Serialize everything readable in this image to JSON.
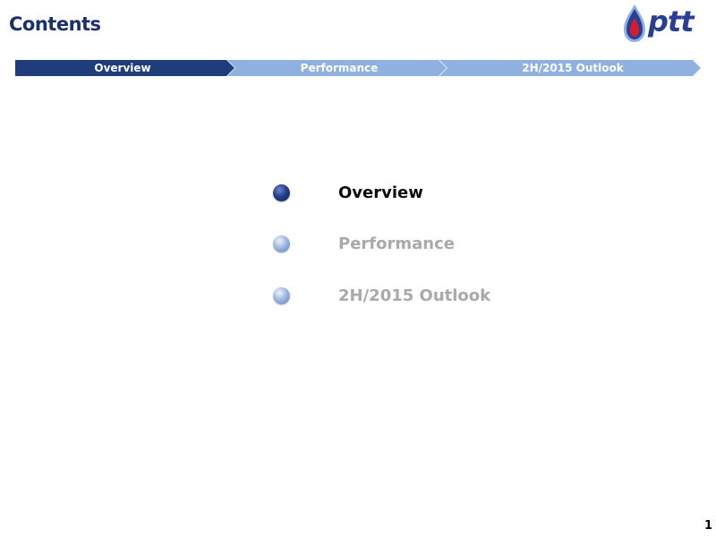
{
  "header": {
    "title": "Contents",
    "logo_text": "ptt"
  },
  "nav": {
    "steps": [
      {
        "label": "Overview",
        "active": true
      },
      {
        "label": "Performance",
        "active": false
      },
      {
        "label": "2H/2015 Outlook",
        "active": false
      }
    ]
  },
  "agenda": {
    "items": [
      {
        "label": "Overview",
        "active": true
      },
      {
        "label": "Performance",
        "active": false
      },
      {
        "label": "2H/2015 Outlook",
        "active": false
      }
    ]
  },
  "footer": {
    "page_number": "1"
  },
  "colors": {
    "title": "#1a2f6b",
    "nav_active": "#1f3d7a",
    "nav_inactive": "#8eb1e0",
    "logo_blue": "#2a3e94",
    "logo_red": "#d51d2a",
    "text_active": "#0b0b0b",
    "text_inactive": "#a9a9a9"
  }
}
